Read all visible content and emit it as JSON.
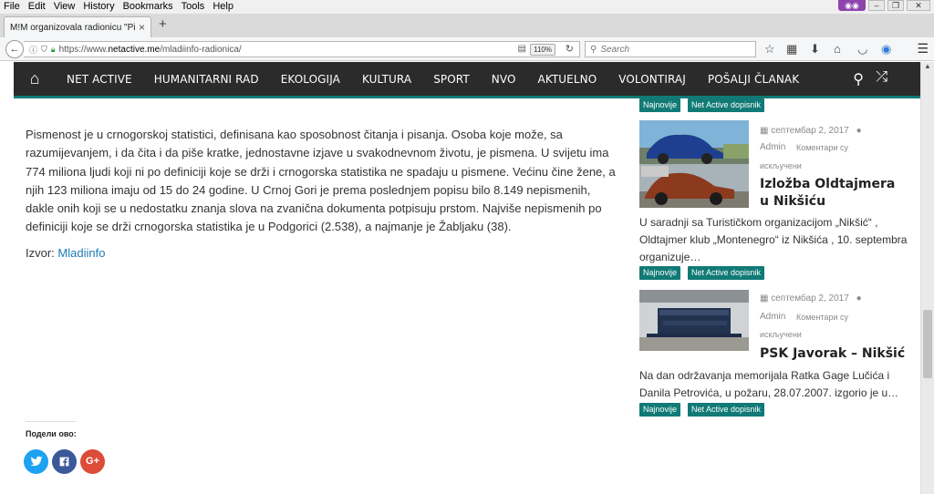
{
  "browser": {
    "menu": [
      "File",
      "Edit",
      "View",
      "History",
      "Bookmarks",
      "Tools",
      "Help"
    ],
    "tab_title": "M!M organizovala radionicu \"Pisr",
    "url_prefix": "https://www.",
    "url_domain": "netactive.me",
    "url_path": "/mladiinfo-radionica/",
    "zoom": "110%",
    "search_placeholder": "Search"
  },
  "site_nav": {
    "items": [
      "NET ACTIVE",
      "HUMANITARNI RAD",
      "EKOLOGIJA",
      "KULTURA",
      "SPORT",
      "NVO",
      "AKTUELNO",
      "VOLONTIRAJ",
      "POŠALJI ČLANAK"
    ],
    "accent_color": "#117a76",
    "bar_color": "#2b2b2b"
  },
  "article": {
    "paragraph": "Pismenost je u crnogorskoj statistici, definisana kao sposobnost čitanja i pisanja. Osoba koje može, sa razumijevanjem, i da čita i da piše kratke, jednostavne izjave u svakodnevnom životu, je pismena. U svijetu ima 774 miliona ljudi koji ni po definiciji koje se drži i crnogorska statistika ne spadaju u pismene. Većinu čine žene, a njih 123 miliona imaju od 15 do 24 godine. U Crnoj Gori je prema poslednjem popisu bilo 8.149 nepismenih, dakle onih koji se u nedostatku znanja slova na zvanična dokumenta potpisuju prstom. Najviše nepismenih po definiciji koje se drži crnogorska statistika je u Podgorici (2.538), a najmanje je Žabljaku (38).",
    "source_label": "Izvor:",
    "source_link": "Mladiinfo",
    "share_label": "Подели ово:",
    "share_icons": [
      "twitter-icon",
      "facebook-icon",
      "google-plus-icon"
    ],
    "share_google_text": "G+"
  },
  "sidebar": {
    "top_tags": [
      "Najnovije",
      "Net Active dopisnik"
    ],
    "posts": [
      {
        "date": "септембар 2, 2017",
        "author": "Admin",
        "comments": "Коментари су",
        "comments_2": "искључени",
        "title": "Izložba Oldtajmera u Nikšiću",
        "excerpt": "U saradnji sa Turističkom organizacijom „Nikšić“ , Oldtajmer klub „Montenegro“ iz Nikšića , 10. septembra organizuje…",
        "tags": [
          "Najnovije",
          "Net Active dopisnik"
        ]
      },
      {
        "date": "септембар 2, 2017",
        "author": "Admin",
        "comments": "Коментари су",
        "comments_2": "искључени",
        "title": "PSK Javorak – Nikšić",
        "excerpt": "Na dan održavanja memorijala Ratka Gage Lučića i Danila Petrovića, u požaru, 28.07.2007. izgorio je u…",
        "tags": [
          "Najnovije",
          "Net Active dopisnik"
        ]
      }
    ]
  }
}
